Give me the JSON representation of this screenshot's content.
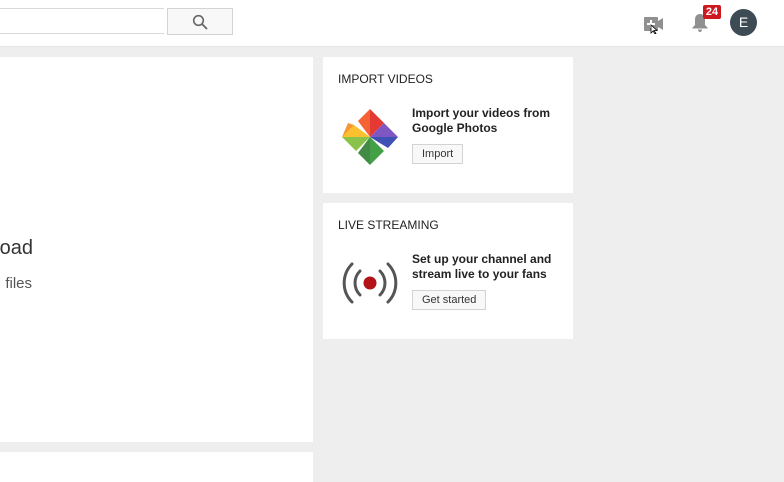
{
  "header": {
    "search": {
      "placeholder": "",
      "value": ""
    },
    "notifications": {
      "count": "24"
    },
    "avatar": {
      "initial": "E"
    }
  },
  "upload": {
    "title": "oad",
    "subtitle": "files"
  },
  "import_card": {
    "title": "IMPORT VIDEOS",
    "description": "Import your videos from Google Photos",
    "button_label": "Import"
  },
  "live_card": {
    "title": "LIVE STREAMING",
    "description": "Set up your channel and stream live to your fans",
    "button_label": "Get started"
  },
  "colors": {
    "badge": "#cc181e",
    "avatar": "#3d4b55",
    "live_dot": "#b31217"
  }
}
